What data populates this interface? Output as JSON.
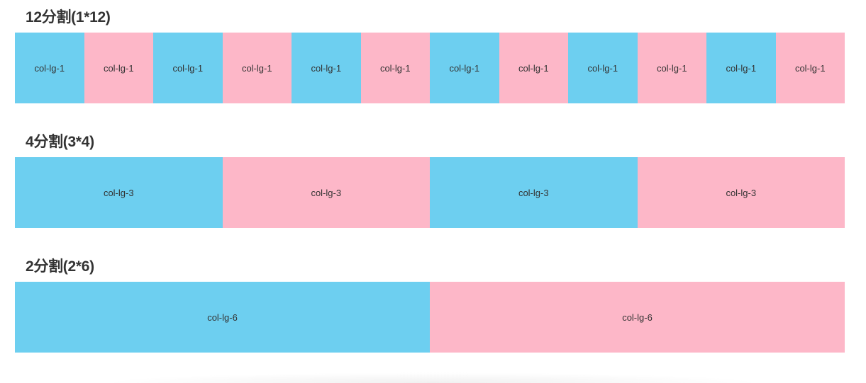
{
  "sections": [
    {
      "title": "12分割(1*12)",
      "cells": [
        "col-lg-1",
        "col-lg-1",
        "col-lg-1",
        "col-lg-1",
        "col-lg-1",
        "col-lg-1",
        "col-lg-1",
        "col-lg-1",
        "col-lg-1",
        "col-lg-1",
        "col-lg-1",
        "col-lg-1"
      ]
    },
    {
      "title": "4分割(3*4)",
      "cells": [
        "col-lg-3",
        "col-lg-3",
        "col-lg-3",
        "col-lg-3"
      ]
    },
    {
      "title": "2分割(2*6)",
      "cells": [
        "col-lg-6",
        "col-lg-6"
      ]
    }
  ],
  "colors": {
    "blue": "#6dcff0",
    "pink": "#fdb7c8",
    "text": "#333333"
  }
}
